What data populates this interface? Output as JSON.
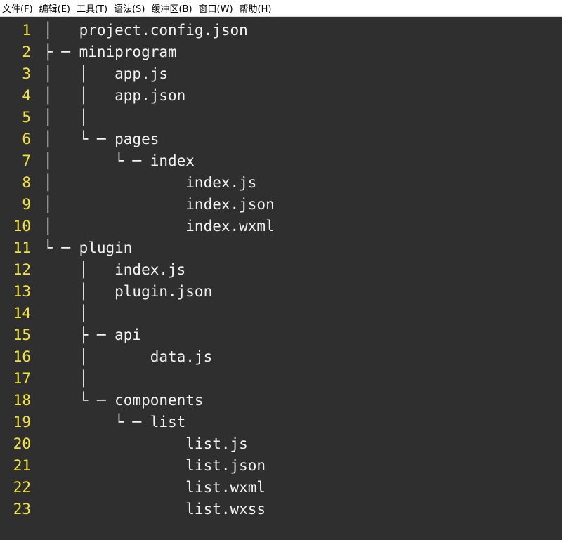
{
  "menubar": {
    "items": [
      "文件(F)",
      "编辑(E)",
      "工具(T)",
      "语法(S)",
      "缓冲区(B)",
      "窗口(W)",
      "帮助(H)"
    ]
  },
  "editor": {
    "lines": [
      {
        "number": "1",
        "text": "│   project.config.json"
      },
      {
        "number": "2",
        "text": "├ ─ miniprogram"
      },
      {
        "number": "3",
        "text": "│   │   app.js"
      },
      {
        "number": "4",
        "text": "│   │   app.json"
      },
      {
        "number": "5",
        "text": "│   │"
      },
      {
        "number": "6",
        "text": "│   └ ─ pages"
      },
      {
        "number": "7",
        "text": "│       └ ─ index"
      },
      {
        "number": "8",
        "text": "│               index.js"
      },
      {
        "number": "9",
        "text": "│               index.json"
      },
      {
        "number": "10",
        "text": "│               index.wxml"
      },
      {
        "number": "11",
        "text": "└ ─ plugin"
      },
      {
        "number": "12",
        "text": "    │   index.js"
      },
      {
        "number": "13",
        "text": "    │   plugin.json"
      },
      {
        "number": "14",
        "text": "    │"
      },
      {
        "number": "15",
        "text": "    ├ ─ api"
      },
      {
        "number": "16",
        "text": "    │       data.js"
      },
      {
        "number": "17",
        "text": "    │"
      },
      {
        "number": "18",
        "text": "    └ ─ components"
      },
      {
        "number": "19",
        "text": "        └ ─ list"
      },
      {
        "number": "20",
        "text": "                list.js"
      },
      {
        "number": "21",
        "text": "                list.json"
      },
      {
        "number": "22",
        "text": "                list.wxml"
      },
      {
        "number": "23",
        "text": "                list.wxss"
      }
    ]
  }
}
